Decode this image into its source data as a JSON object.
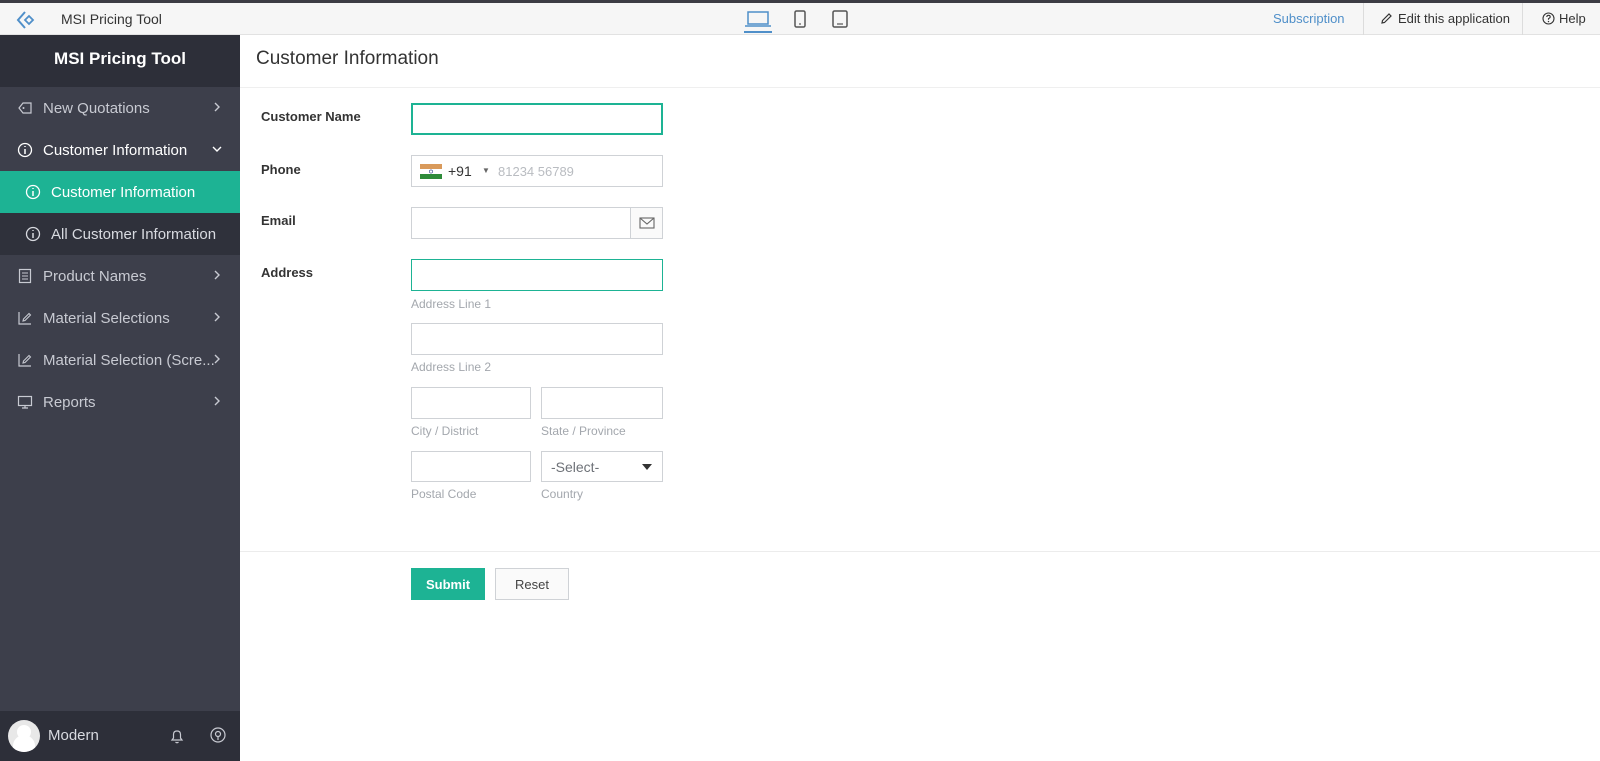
{
  "topbar": {
    "app_title": "MSI Pricing Tool",
    "subscription": "Subscription",
    "edit_app": "Edit this application",
    "help": "Help",
    "active_device": "laptop"
  },
  "sidebar": {
    "brand": "MSI Pricing Tool",
    "items": [
      {
        "label": "New Quotations",
        "icon": "quotation-icon"
      },
      {
        "label": "Customer Information",
        "icon": "info-icon",
        "expanded": true,
        "children": [
          {
            "label": "Customer Information",
            "active": true
          },
          {
            "label": "All Customer Information",
            "active": false
          }
        ]
      },
      {
        "label": "Product Names",
        "icon": "list-icon"
      },
      {
        "label": "Material Selections",
        "icon": "edit-list-icon"
      },
      {
        "label": "Material Selection (Scre...",
        "icon": "edit-list-icon"
      },
      {
        "label": "Reports",
        "icon": "monitor-icon"
      }
    ],
    "footer": {
      "user": "Modern"
    }
  },
  "main": {
    "title": "Customer Information",
    "form": {
      "customer_name_label": "Customer Name",
      "customer_name_value": "",
      "phone_label": "Phone",
      "phone_code": "+91",
      "phone_placeholder": "81234 56789",
      "email_label": "Email",
      "address_label": "Address",
      "address_line1_hint": "Address Line 1",
      "address_line2_hint": "Address Line 2",
      "city_hint": "City / District",
      "state_hint": "State / Province",
      "postal_hint": "Postal Code",
      "country_hint": "Country",
      "country_value": "-Select-"
    },
    "buttons": {
      "submit": "Submit",
      "reset": "Reset"
    }
  },
  "colors": {
    "accent": "#1db394",
    "link": "#4f8fc9",
    "sidebar_bg": "#3d3f4b"
  }
}
